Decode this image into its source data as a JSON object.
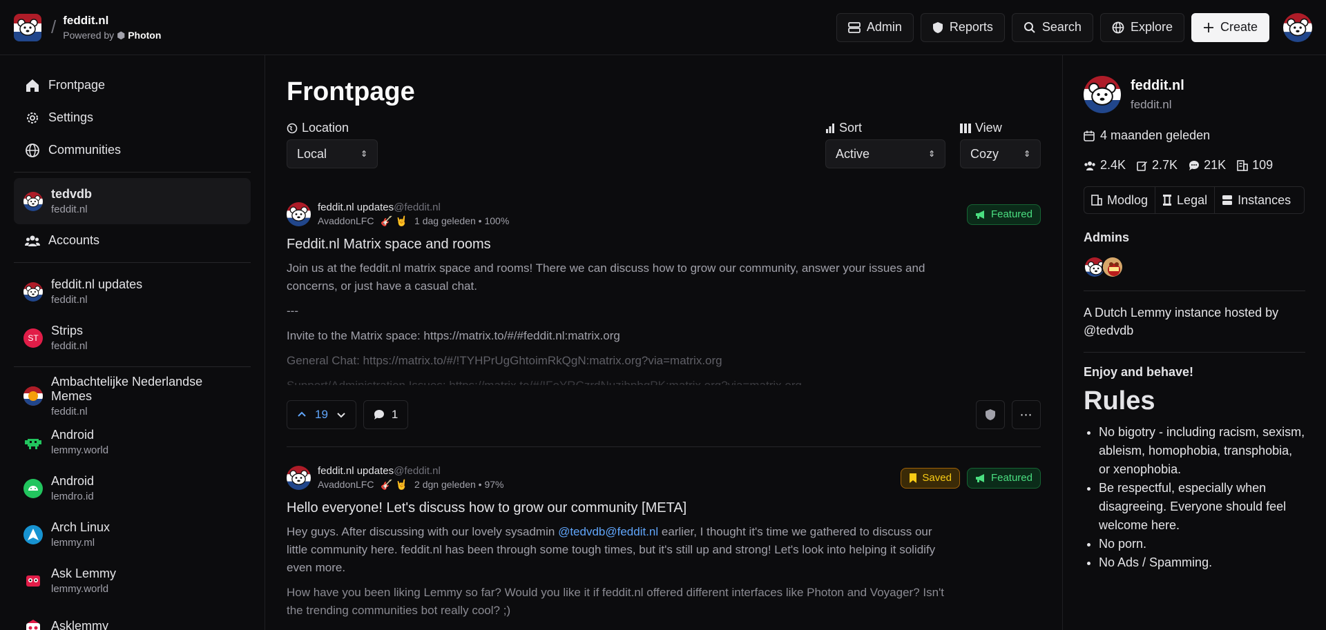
{
  "topbar": {
    "site_name": "feddit.nl",
    "powered_by": "Powered by",
    "powered_name": "Photon",
    "buttons": {
      "admin": "Admin",
      "reports": "Reports",
      "search": "Search",
      "explore": "Explore",
      "create": "Create"
    }
  },
  "sidebar": {
    "nav": {
      "frontpage": "Frontpage",
      "settings": "Settings",
      "communities": "Communities"
    },
    "account": {
      "name": "tedvdb",
      "instance": "feddit.nl"
    },
    "accounts_label": "Accounts",
    "favorites": [
      {
        "name": "feddit.nl updates",
        "instance": "feddit.nl"
      },
      {
        "name": "Strips",
        "instance": "feddit.nl",
        "initials": "ST"
      }
    ],
    "communities": [
      {
        "name": "Ambachtelijke Nederlandse Memes",
        "instance": "feddit.nl"
      },
      {
        "name": "Android",
        "instance": "lemmy.world"
      },
      {
        "name": "Android",
        "instance": "lemdro.id"
      },
      {
        "name": "Arch Linux",
        "instance": "lemmy.ml"
      },
      {
        "name": "Ask Lemmy",
        "instance": "lemmy.world"
      },
      {
        "name": "Asklemmy",
        "instance": ""
      }
    ]
  },
  "main": {
    "title": "Frontpage",
    "location": {
      "label": "Location",
      "value": "Local"
    },
    "sort": {
      "label": "Sort",
      "value": "Active"
    },
    "view": {
      "label": "View",
      "value": "Cozy"
    },
    "posts": [
      {
        "community": "feddit.nl updates",
        "community_instance": "@feddit.nl",
        "author": "AvaddonLFC",
        "emoji": "🎸 🤘",
        "time": "1 dag geleden",
        "ratio": "100%",
        "badge_featured": "Featured",
        "title": "Feddit.nl Matrix space and rooms",
        "body": [
          "Join us at the feddit.nl matrix space and rooms! There we can discuss how to grow our community, answer your issues and concerns, or just have a casual chat.",
          "---",
          "Invite to the Matrix space: https://matrix.to/#/#feddit.nl:matrix.org",
          "General Chat: https://matrix.to/#/!TYHPrUgGhtoimRkQgN:matrix.org?via=matrix.org",
          "Support/Administration Issues: https://matrix.to/#/!FoYRCzrdNuzjhpbqPK:matrix.org?via=matrix.org"
        ],
        "score": "19",
        "comments": "1"
      },
      {
        "community": "feddit.nl updates",
        "community_instance": "@feddit.nl",
        "author": "AvaddonLFC",
        "emoji": "🎸 🤘",
        "time": "2 dgn geleden",
        "ratio": "97%",
        "badge_saved": "Saved",
        "badge_featured": "Featured",
        "title": "Hello everyone! Let's discuss how to grow our community [META]",
        "body_a": "Hey guys. After discussing with our lovely sysadmin",
        "mention": "@tedvdb@feddit.nl",
        "body_b": "earlier, I thought it's time we gathered to discuss our little community here. feddit.nl has been through some tough times, but it's still up and strong! Let's look into helping it solidify even more.",
        "body_c": "How have you been liking Lemmy so far? Would you like it if feddit.nl offered different interfaces like Photon and Voyager? Isn't the trending communities bot really cool? ;)"
      }
    ]
  },
  "right": {
    "name": "feddit.nl",
    "instance": "feddit.nl",
    "age": "4 maanden geleden",
    "stats": {
      "users": "2.4K",
      "posts": "2.7K",
      "comments": "21K",
      "communities": "109"
    },
    "links": {
      "modlog": "Modlog",
      "legal": "Legal",
      "instances": "Instances"
    },
    "admins_title": "Admins",
    "description": "A Dutch Lemmy instance hosted by @tedvdb",
    "enjoy": "Enjoy and behave!",
    "rules_title": "Rules",
    "rules": [
      "No bigotry - including racism, sexism, ableism, homophobia, transphobia, or xenophobia.",
      "Be respectful, especially when disagreeing. Everyone should feel welcome here.",
      "No porn.",
      "No Ads / Spamming."
    ]
  }
}
